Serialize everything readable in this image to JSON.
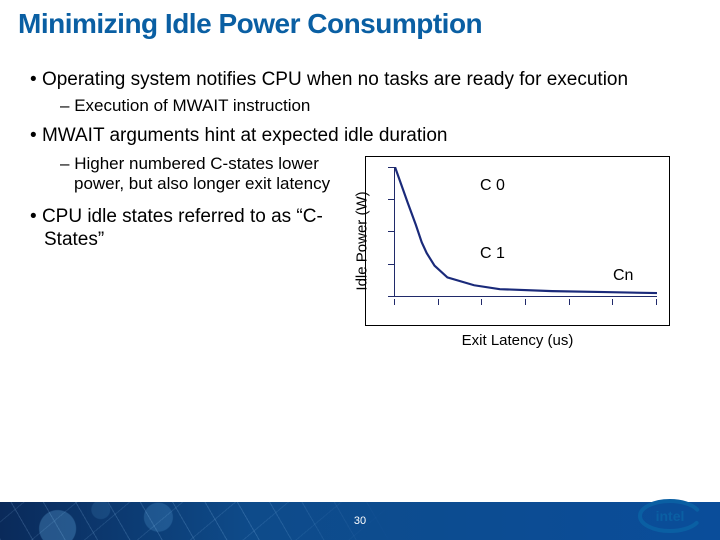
{
  "title": "Minimizing Idle Power Consumption",
  "bullets": {
    "b1": "Operating system notifies CPU when no tasks are ready for execution",
    "s1": "Execution of MWAIT instruction",
    "b2": "MWAIT arguments hint at expected idle duration",
    "s2": "Higher numbered C-states lower power, but also longer exit latency",
    "b3": "CPU idle states referred to as “C-States”"
  },
  "chart_data": {
    "type": "line",
    "title": "",
    "xlabel": "Exit Latency (us)",
    "ylabel": "Idle Power (W)",
    "xlim": [
      0,
      10
    ],
    "ylim": [
      0,
      10
    ],
    "x": [
      0,
      0.5,
      0.8,
      1.0,
      1.2,
      1.5,
      2.0,
      3.0,
      4.0,
      6.0,
      8.0,
      10.0
    ],
    "y": [
      10.0,
      7.2,
      5.5,
      4.2,
      3.3,
      2.3,
      1.4,
      0.8,
      0.55,
      0.35,
      0.28,
      0.25
    ],
    "annotations": [
      {
        "label": "C 0",
        "x": 3.5,
        "y": 8.2
      },
      {
        "label": "C 1",
        "x": 3.5,
        "y": 3.0
      },
      {
        "label": "Cn",
        "x": 8.5,
        "y": 1.5
      }
    ]
  },
  "footer": {
    "page_number": "30",
    "logo": "intel"
  }
}
